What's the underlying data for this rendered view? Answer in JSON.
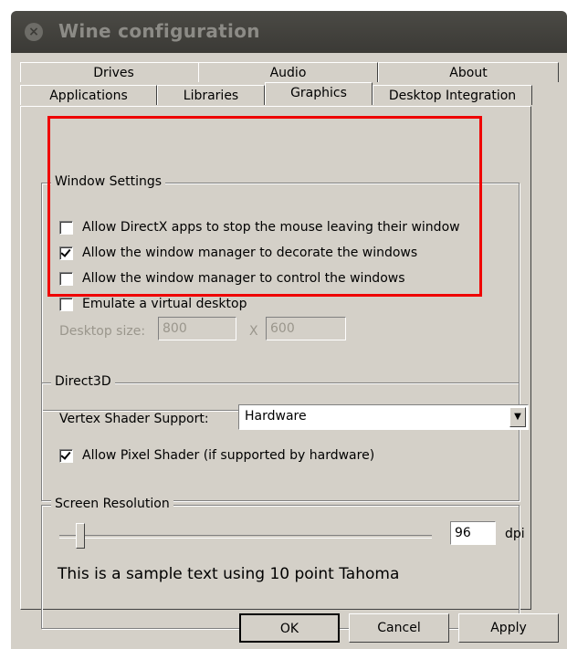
{
  "window": {
    "title": "Wine configuration",
    "close_symbol": "×"
  },
  "tabs": {
    "row1": [
      "Drives",
      "Audio",
      "About"
    ],
    "row2": [
      "Applications",
      "Libraries",
      "Graphics",
      "Desktop Integration"
    ],
    "active": "Graphics"
  },
  "window_settings": {
    "title": "Window Settings",
    "options": [
      {
        "label": "Allow DirectX apps to stop the mouse leaving their window",
        "checked": false
      },
      {
        "label": "Allow the window manager to decorate the windows",
        "checked": true
      },
      {
        "label": "Allow the window manager to control the windows",
        "checked": false
      },
      {
        "label": "Emulate a virtual desktop",
        "checked": false
      }
    ],
    "desktop_size_label": "Desktop size:",
    "width_value": "800",
    "separator": "X",
    "height_value": "600"
  },
  "direct3d": {
    "title": "Direct3D",
    "vertex_label": "Vertex Shader Support:",
    "vertex_value": "Hardware",
    "pixel_shader_label": "Allow Pixel Shader (if supported by hardware)",
    "pixel_shader_checked": true
  },
  "screen_resolution": {
    "title": "Screen Resolution",
    "dpi_value": "96",
    "dpi_unit": "dpi",
    "sample_text": "This is a sample text using 10 point Tahoma",
    "slider_position_fraction": 0.0
  },
  "buttons": {
    "ok": "OK",
    "cancel": "Cancel",
    "apply": "Apply"
  },
  "colors": {
    "highlight": "#ef0000",
    "dialog_bg": "#d4d0c8",
    "titlebar": "#3c3b37"
  }
}
